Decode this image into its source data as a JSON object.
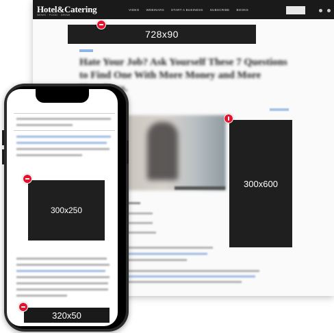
{
  "site": {
    "logo": "Hotel&Catering",
    "logo_sub": "NEWS · FOOD · DRINK",
    "nav": [
      "VIDEO",
      "WEBINARS",
      "START A BUSINESS",
      "SUBSCRIBE",
      "BOOKS"
    ]
  },
  "article": {
    "headline": "Hate Your Job? Ask Yourself These 7 Questions to Find One With More Money and More Happiness."
  },
  "ads": {
    "leaderboard": "728x90",
    "half_page": "300x600",
    "medium_rectangle": "300x250",
    "mobile_banner": "320x50"
  },
  "colors": {
    "marker": "#e8112d",
    "ad_background": "#1f1f1f",
    "topbar": "#1a1a1a"
  },
  "icons": {
    "marker": "red-circle-minus-icon"
  }
}
